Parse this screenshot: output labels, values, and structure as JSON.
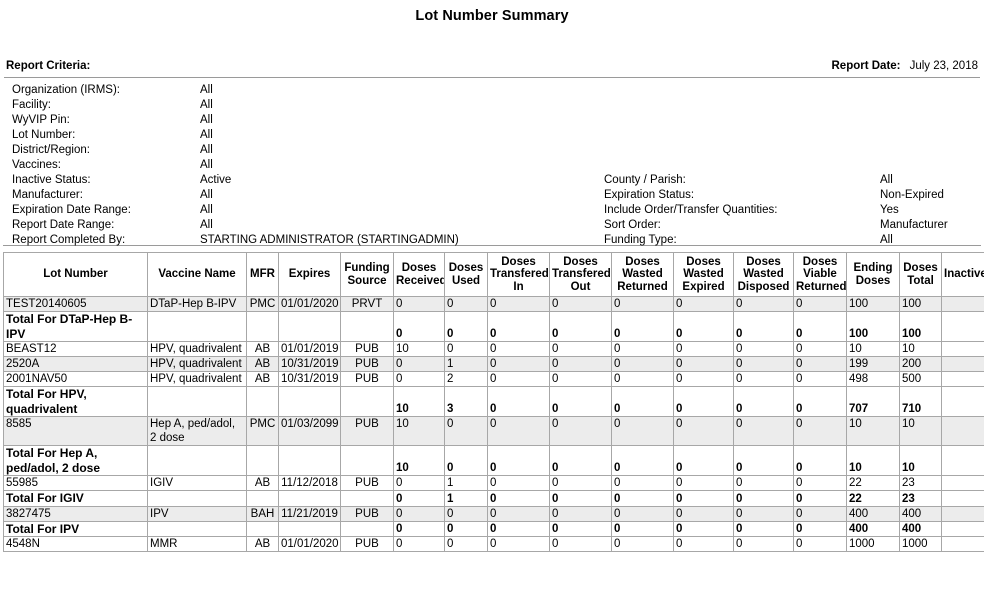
{
  "report": {
    "title": "Lot Number Summary",
    "criteria_label": "Report Criteria:",
    "report_date_label": "Report Date:",
    "report_date_value": "July 23, 2018"
  },
  "criteria_left": [
    {
      "key": "Organization (IRMS):",
      "value": "All"
    },
    {
      "key": "Facility:",
      "value": "All"
    },
    {
      "key": "WyVIP Pin:",
      "value": "All"
    },
    {
      "key": "Lot Number:",
      "value": "All"
    },
    {
      "key": "District/Region:",
      "value": "All"
    },
    {
      "key": "Vaccines:",
      "value": "All"
    },
    {
      "key": "Inactive Status:",
      "value": "Active"
    },
    {
      "key": "Manufacturer:",
      "value": "All"
    },
    {
      "key": "Expiration Date Range:",
      "value": "All"
    },
    {
      "key": "Report Date Range:",
      "value": "All"
    },
    {
      "key": "Report Completed By:",
      "value": "STARTING ADMINISTRATOR (STARTINGADMIN)"
    }
  ],
  "criteria_right": [
    {
      "key": "County / Parish:",
      "value": "All"
    },
    {
      "key": "Expiration Status:",
      "value": "Non-Expired"
    },
    {
      "key": "Include Order/Transfer Quantities:",
      "value": "Yes"
    },
    {
      "key": "Sort Order:",
      "value": "Manufacturer"
    },
    {
      "key": "Funding Type:",
      "value": "All"
    }
  ],
  "table": {
    "columns": [
      "Lot Number",
      "Vaccine Name",
      "MFR",
      "Expires",
      "Funding Source",
      "Doses Received",
      "Doses Used",
      "Doses Transfered In",
      "Doses Transfered Out",
      "Doses Wasted Returned",
      "Doses Wasted Expired",
      "Doses Wasted Disposed",
      "Doses Viable Returned",
      "Ending Doses",
      "Doses Total",
      "Inactive"
    ],
    "rows": [
      {
        "type": "data",
        "shaded": true,
        "lot": "TEST20140605",
        "vaccine": "DTaP-Hep B-IPV",
        "mfr": "PMC",
        "expires": "01/01/2020",
        "funding": "PRVT",
        "received": "0",
        "used": "0",
        "transfer_in": "0",
        "transfer_out": "0",
        "wasted_returned": "0",
        "wasted_expired": "0",
        "wasted_disposed": "0",
        "viable_returned": "0",
        "ending": "100",
        "total": "100",
        "inactive": ""
      },
      {
        "type": "total",
        "shaded": false,
        "lot": "Total For DTaP-Hep B-IPV",
        "vaccine": "",
        "mfr": "",
        "expires": "",
        "funding": "",
        "received": "0",
        "used": "0",
        "transfer_in": "0",
        "transfer_out": "0",
        "wasted_returned": "0",
        "wasted_expired": "0",
        "wasted_disposed": "0",
        "viable_returned": "0",
        "ending": "100",
        "total": "100",
        "inactive": ""
      },
      {
        "type": "data",
        "shaded": false,
        "lot": "BEAST12",
        "vaccine": "HPV, quadrivalent",
        "mfr": "AB",
        "expires": "01/01/2019",
        "funding": "PUB",
        "received": "10",
        "used": "0",
        "transfer_in": "0",
        "transfer_out": "0",
        "wasted_returned": "0",
        "wasted_expired": "0",
        "wasted_disposed": "0",
        "viable_returned": "0",
        "ending": "10",
        "total": "10",
        "inactive": ""
      },
      {
        "type": "data",
        "shaded": true,
        "lot": "2520A",
        "vaccine": "HPV, quadrivalent",
        "mfr": "AB",
        "expires": "10/31/2019",
        "funding": "PUB",
        "received": "0",
        "used": "1",
        "transfer_in": "0",
        "transfer_out": "0",
        "wasted_returned": "0",
        "wasted_expired": "0",
        "wasted_disposed": "0",
        "viable_returned": "0",
        "ending": "199",
        "total": "200",
        "inactive": ""
      },
      {
        "type": "data",
        "shaded": false,
        "lot": "2001NAV50",
        "vaccine": "HPV, quadrivalent",
        "mfr": "AB",
        "expires": "10/31/2019",
        "funding": "PUB",
        "received": "0",
        "used": "2",
        "transfer_in": "0",
        "transfer_out": "0",
        "wasted_returned": "0",
        "wasted_expired": "0",
        "wasted_disposed": "0",
        "viable_returned": "0",
        "ending": "498",
        "total": "500",
        "inactive": ""
      },
      {
        "type": "total",
        "shaded": false,
        "lot": "Total For HPV, quadrivalent",
        "vaccine": "",
        "mfr": "",
        "expires": "",
        "funding": "",
        "received": "10",
        "used": "3",
        "transfer_in": "0",
        "transfer_out": "0",
        "wasted_returned": "0",
        "wasted_expired": "0",
        "wasted_disposed": "0",
        "viable_returned": "0",
        "ending": "707",
        "total": "710",
        "inactive": ""
      },
      {
        "type": "data",
        "shaded": true,
        "lot": "8585",
        "vaccine": "Hep A, ped/adol, 2 dose",
        "mfr": "PMC",
        "expires": "01/03/2099",
        "funding": "PUB",
        "received": "10",
        "used": "0",
        "transfer_in": "0",
        "transfer_out": "0",
        "wasted_returned": "0",
        "wasted_expired": "0",
        "wasted_disposed": "0",
        "viable_returned": "0",
        "ending": "10",
        "total": "10",
        "inactive": ""
      },
      {
        "type": "total",
        "shaded": false,
        "lot": "Total For Hep A, ped/adol, 2 dose",
        "vaccine": "",
        "mfr": "",
        "expires": "",
        "funding": "",
        "received": "10",
        "used": "0",
        "transfer_in": "0",
        "transfer_out": "0",
        "wasted_returned": "0",
        "wasted_expired": "0",
        "wasted_disposed": "0",
        "viable_returned": "0",
        "ending": "10",
        "total": "10",
        "inactive": ""
      },
      {
        "type": "data",
        "shaded": false,
        "lot": "55985",
        "vaccine": "IGIV",
        "mfr": "AB",
        "expires": "11/12/2018",
        "funding": "PUB",
        "received": "0",
        "used": "1",
        "transfer_in": "0",
        "transfer_out": "0",
        "wasted_returned": "0",
        "wasted_expired": "0",
        "wasted_disposed": "0",
        "viable_returned": "0",
        "ending": "22",
        "total": "23",
        "inactive": ""
      },
      {
        "type": "total",
        "shaded": false,
        "lot": "Total For IGIV",
        "vaccine": "",
        "mfr": "",
        "expires": "",
        "funding": "",
        "received": "0",
        "used": "1",
        "transfer_in": "0",
        "transfer_out": "0",
        "wasted_returned": "0",
        "wasted_expired": "0",
        "wasted_disposed": "0",
        "viable_returned": "0",
        "ending": "22",
        "total": "23",
        "inactive": ""
      },
      {
        "type": "data",
        "shaded": true,
        "lot": "3827475",
        "vaccine": "IPV",
        "mfr": "BAH",
        "expires": "11/21/2019",
        "funding": "PUB",
        "received": "0",
        "used": "0",
        "transfer_in": "0",
        "transfer_out": "0",
        "wasted_returned": "0",
        "wasted_expired": "0",
        "wasted_disposed": "0",
        "viable_returned": "0",
        "ending": "400",
        "total": "400",
        "inactive": ""
      },
      {
        "type": "total",
        "shaded": false,
        "lot": "Total For IPV",
        "vaccine": "",
        "mfr": "",
        "expires": "",
        "funding": "",
        "received": "0",
        "used": "0",
        "transfer_in": "0",
        "transfer_out": "0",
        "wasted_returned": "0",
        "wasted_expired": "0",
        "wasted_disposed": "0",
        "viable_returned": "0",
        "ending": "400",
        "total": "400",
        "inactive": ""
      },
      {
        "type": "data",
        "shaded": false,
        "lot": "4548N",
        "vaccine": "MMR",
        "mfr": "AB",
        "expires": "01/01/2020",
        "funding": "PUB",
        "received": "0",
        "used": "0",
        "transfer_in": "0",
        "transfer_out": "0",
        "wasted_returned": "0",
        "wasted_expired": "0",
        "wasted_disposed": "0",
        "viable_returned": "0",
        "ending": "1000",
        "total": "1000",
        "inactive": ""
      }
    ]
  }
}
